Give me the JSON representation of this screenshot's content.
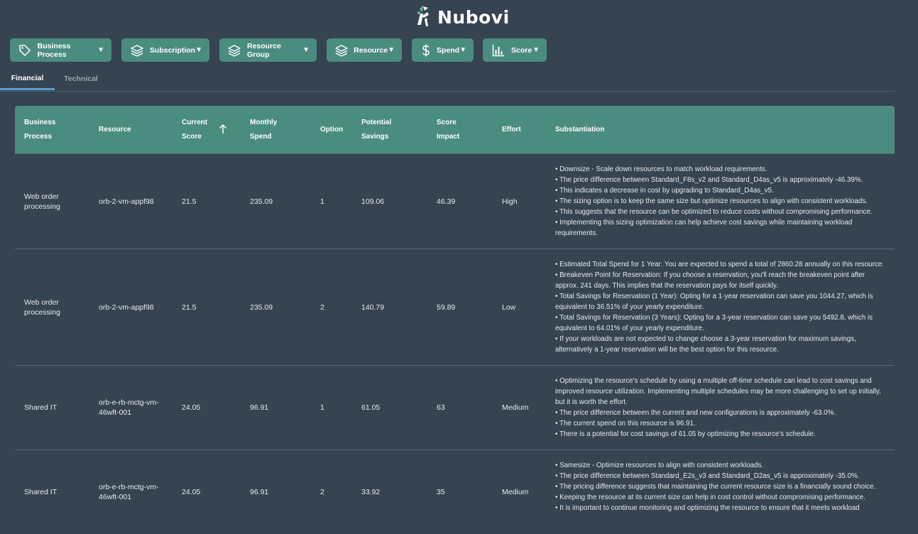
{
  "brand": {
    "name": "Nubovi"
  },
  "filters": [
    {
      "label": "Business Process",
      "icon": "tag-icon"
    },
    {
      "label": "Subscription",
      "icon": "layers-icon"
    },
    {
      "label": "Resource Group",
      "icon": "layers-icon"
    },
    {
      "label": "Resource",
      "icon": "layers-icon"
    },
    {
      "label": "Spend",
      "icon": "dollar-icon"
    },
    {
      "label": "Score",
      "icon": "bar-chart-icon"
    }
  ],
  "tabs": [
    {
      "label": "Financial",
      "active": true
    },
    {
      "label": "Technical",
      "active": false
    }
  ],
  "table": {
    "headers": {
      "business_process": [
        "Business",
        "Process"
      ],
      "resource": "Resource",
      "current_score": [
        "Current",
        "Score"
      ],
      "monthly_spend": [
        "Monthly",
        "Spend"
      ],
      "option": "Option",
      "potential_savings": [
        "Potential",
        "Savings"
      ],
      "score_impact": [
        "Score",
        "Impact"
      ],
      "effort": "Effort",
      "substantiation": "Substantiation"
    },
    "sort": {
      "column": "current_score",
      "direction": "ascending",
      "icon": "arrow-up-icon"
    },
    "rows": [
      {
        "business_process": "Web order processing",
        "resource": "orb-2-vm-appf98",
        "current_score": "21.5",
        "monthly_spend": "235.09",
        "option": "1",
        "potential_savings": "109.06",
        "score_impact": "46.39",
        "effort": "High",
        "substantiation": [
          "• Downsize - Scale down resources to match workload requirements.",
          "• The price difference between Standard_F8s_v2 and Standard_D4as_v5 is approximately -46.39%.",
          "• This indicates a decrease in cost by upgrading to Standard_D4as_v5.",
          "• The sizing option is to keep the same size but optimize resources to align with consistent workloads.",
          "• This suggests that the resource can be optimized to reduce costs without compromising performance.",
          "• Implementing this sizing optimization can help achieve cost savings while maintaining workload requirements."
        ]
      },
      {
        "business_process": "Web order processing",
        "resource": "orb-2-vm-appf98",
        "current_score": "21.5",
        "monthly_spend": "235.09",
        "option": "2",
        "potential_savings": "140.79",
        "score_impact": "59.89",
        "effort": "Low",
        "substantiation": [
          "• Estimated Total Spend for 1 Year: You are expected to spend a total of 2860.28 annually on this resource.",
          "• Breakeven Point for Reservation: If you choose a reservation, you'll reach the breakeven point after approx. 241 days. This implies that the reservation pays for itself quickly.",
          "• Total Savings for Reservation (1 Year): Opting for a 1-year reservation can save you 1044.27, which is equivalent to 36.51% of your yearly expenditure.",
          "• Total Savings for Reservation (3 Years): Opting for a 3-year reservation can save you 5492.8, which is equivalent to 64.01% of your yearly expenditure.",
          "• If your workloads are not expected to change choose a 3-year reservation for maximum savings, alternatively a 1-year reservation will be the best option for this resource."
        ]
      },
      {
        "business_process": "Shared IT",
        "resource": "orb-e-rb-mctg-vm-46wft-001",
        "current_score": "24.05",
        "monthly_spend": "96.91",
        "option": "1",
        "potential_savings": "61.05",
        "score_impact": "63",
        "effort": "Medium",
        "substantiation": [
          "• Optimizing the resource's schedule by using a multiple off-time schedule can lead to cost savings and improved resource utilization. Implementing multiple schedules may be more challenging to set up initially, but it is worth the effort.",
          "• The price difference between the current and new configurations is approximately -63.0%.",
          "• The current spend on this resource is 96.91.",
          "• There is a potential for cost savings of 61.05 by optimizing the resource's schedule."
        ]
      },
      {
        "business_process": "Shared IT",
        "resource": "orb-e-rb-mctg-vm-46wft-001",
        "current_score": "24.05",
        "monthly_spend": "96.91",
        "option": "2",
        "potential_savings": "33.92",
        "score_impact": "35",
        "effort": "Medium",
        "substantiation": [
          "• Samesize - Optimize resources to align with consistent workloads.",
          "• The price difference between Standard_E2s_v3 and Standard_D2as_v5 is approximately -35.0%.",
          "• The pricing difference suggests that maintaining the current resource size is a financially sound choice.",
          "• Keeping the resource at its current size can help in cost control without compromising performance.",
          "• It is important to continue monitoring and optimizing the resource to ensure that it meets workload"
        ]
      }
    ]
  }
}
